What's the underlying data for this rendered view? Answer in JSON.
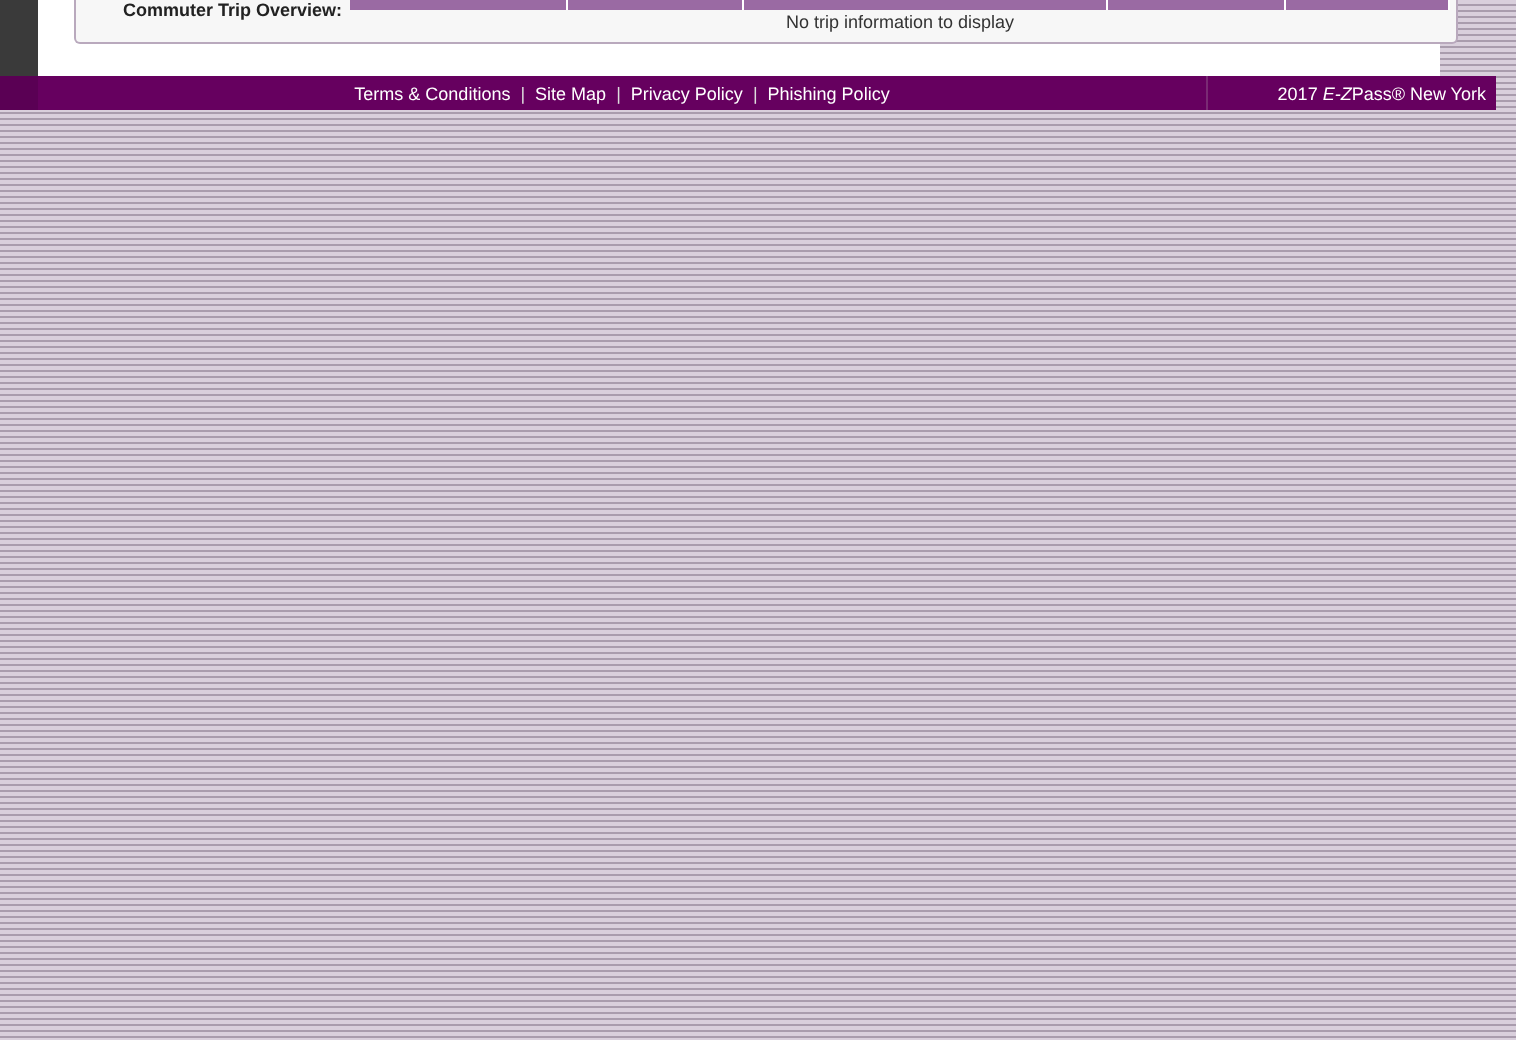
{
  "trip_overview": {
    "label": "Commuter Trip Overview:",
    "empty_message": "No trip information to display"
  },
  "footer": {
    "links": [
      "Terms & Conditions",
      "Site Map",
      "Privacy Policy",
      "Phishing Policy"
    ],
    "separator": "|",
    "copyright": {
      "year": "2017",
      "brand_italic": "E-Z",
      "brand_rest": "Pass® New York"
    }
  }
}
